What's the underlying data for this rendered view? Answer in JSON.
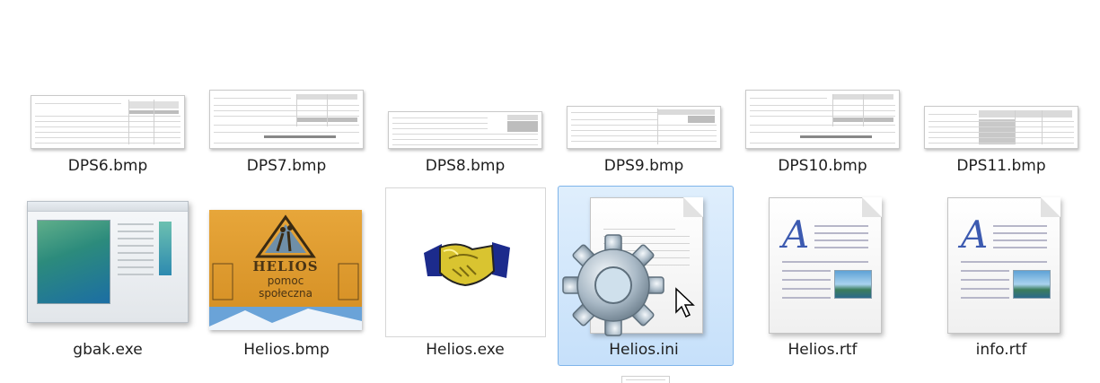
{
  "files": [
    {
      "name": "DPS6.bmp",
      "icon": "spreadsheet-thumbnail-icon"
    },
    {
      "name": "DPS7.bmp",
      "icon": "spreadsheet-thumbnail-icon"
    },
    {
      "name": "DPS8.bmp",
      "icon": "spreadsheet-thumbnail-icon"
    },
    {
      "name": "DPS9.bmp",
      "icon": "spreadsheet-thumbnail-icon"
    },
    {
      "name": "DPS10.bmp",
      "icon": "spreadsheet-thumbnail-icon"
    },
    {
      "name": "DPS11.bmp",
      "icon": "spreadsheet-thumbnail-icon"
    },
    {
      "name": "gbak.exe",
      "icon": "application-window-icon"
    },
    {
      "name": "Helios.bmp",
      "icon": "helios-image-thumbnail"
    },
    {
      "name": "Helios.exe",
      "icon": "handshake-icon"
    },
    {
      "name": "Helios.ini",
      "icon": "settings-gear-file-icon"
    },
    {
      "name": "Helios.rtf",
      "icon": "rich-text-document-icon"
    },
    {
      "name": "info.rtf",
      "icon": "rich-text-document-icon"
    }
  ],
  "helios_thumbnail": {
    "title": "HELIOS",
    "subtitle_line1": "pomoc",
    "subtitle_line2": "społeczna"
  },
  "rtf_glyph": "A",
  "selected_file": "Helios.ini",
  "colors": {
    "selection_fill": "#cce4fb",
    "selection_border": "#7eb4ea",
    "label_text": "#1e1e1e"
  }
}
